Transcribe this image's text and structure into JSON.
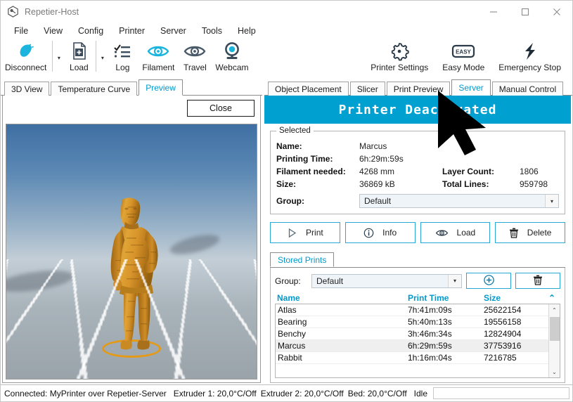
{
  "window": {
    "title": "Repetier-Host",
    "app_icon": "repetier-logo-icon",
    "minimize": "—",
    "maximize": "▢",
    "close": "✕"
  },
  "menubar": {
    "items": [
      {
        "label": "File"
      },
      {
        "label": "View"
      },
      {
        "label": "Config"
      },
      {
        "label": "Printer"
      },
      {
        "label": "Server"
      },
      {
        "label": "Tools"
      },
      {
        "label": "Help"
      }
    ]
  },
  "toolbar": {
    "left": [
      {
        "label": "Disconnect",
        "icon": "plug-disconnect-icon",
        "has_dropdown": true
      },
      {
        "label": "Load",
        "icon": "file-add-icon",
        "has_dropdown": true
      },
      {
        "label": "Log",
        "icon": "checklist-icon",
        "has_dropdown": false
      },
      {
        "label": "Filament",
        "icon": "eye-filament-icon",
        "has_dropdown": false
      },
      {
        "label": "Travel",
        "icon": "eye-travel-icon",
        "has_dropdown": false
      },
      {
        "label": "Webcam",
        "icon": "webcam-icon",
        "has_dropdown": false
      }
    ],
    "right": [
      {
        "label": "Printer Settings",
        "icon": "gear-icon"
      },
      {
        "label": "Easy Mode",
        "icon": "easy-badge-icon"
      },
      {
        "label": "Emergency Stop",
        "icon": "lightning-bolt-icon"
      }
    ],
    "dropdown_glyph": "▾"
  },
  "left_panel": {
    "tabs": [
      {
        "label": "3D View",
        "active": false
      },
      {
        "label": "Temperature Curve",
        "active": false
      },
      {
        "label": "Preview",
        "active": true
      }
    ],
    "close_button": "Close",
    "viewport": {
      "model_name": "Marcus",
      "model_color": "#d8962a",
      "sky_color": "#4878ab",
      "floor_color": "#a9b3ba",
      "selection_ring_color": "#e59a16"
    }
  },
  "right_panel": {
    "tabs": [
      {
        "label": "Object Placement",
        "active": false
      },
      {
        "label": "Slicer",
        "active": false
      },
      {
        "label": "Print Preview",
        "active": false
      },
      {
        "label": "Server",
        "active": true
      },
      {
        "label": "Manual Control",
        "active": false
      }
    ],
    "banner": {
      "text": "Printer Deactivated",
      "background": "#00a0d0",
      "color": "#ffffff"
    },
    "selected": {
      "title": "Selected",
      "name_label": "Name:",
      "name_value": "Marcus",
      "printing_time_label": "Printing Time:",
      "printing_time_value": "6h:29m:59s",
      "filament_label": "Filament needed:",
      "filament_value": "4268 mm",
      "size_label": "Size:",
      "size_value": "36869 kB",
      "layer_count_label": "Layer Count:",
      "layer_count_value": "1806",
      "total_lines_label": "Total Lines:",
      "total_lines_value": "959798",
      "group_label": "Group:",
      "group_value": "Default",
      "group_arrow": "▾"
    },
    "actions": [
      {
        "label": "Print",
        "icon": "play-triangle-icon"
      },
      {
        "label": "Info",
        "icon": "info-circle-icon"
      },
      {
        "label": "Load",
        "icon": "eye-icon"
      },
      {
        "label": "Delete",
        "icon": "trash-icon"
      }
    ],
    "stored_prints": {
      "tab_label": "Stored Prints",
      "group_label": "Group:",
      "group_value": "Default",
      "group_arrow": "▾",
      "add_button_icon": "plus-circle-icon",
      "delete_button_icon": "trash-icon",
      "columns": {
        "name": "Name",
        "print_time": "Print Time",
        "size": "Size"
      },
      "sort_arrow": "⌃",
      "rows": [
        {
          "name": "Atlas",
          "print_time": "7h:41m:09s",
          "size": "25622154",
          "selected": false
        },
        {
          "name": "Bearing",
          "print_time": "5h:40m:13s",
          "size": "19556158",
          "selected": false
        },
        {
          "name": "Benchy",
          "print_time": "3h:46m:34s",
          "size": "12824904",
          "selected": false
        },
        {
          "name": "Marcus",
          "print_time": "6h:29m:59s",
          "size": "37753916",
          "selected": true
        },
        {
          "name": "Rabbit",
          "print_time": "1h:16m:04s",
          "size": "7216785",
          "selected": false
        }
      ],
      "scroll_up": "⌃",
      "scroll_down": "⌄"
    }
  },
  "statusbar": {
    "connection": "Connected: MyPrinter over Repetier-Server",
    "extruder1": "Extruder 1: 20,0°C/Off",
    "extruder2": "Extruder 2: 20,0°C/Off",
    "bed": "Bed: 20,0°C/Off",
    "state": "Idle"
  },
  "cursor": {
    "name": "mouse-pointer"
  }
}
